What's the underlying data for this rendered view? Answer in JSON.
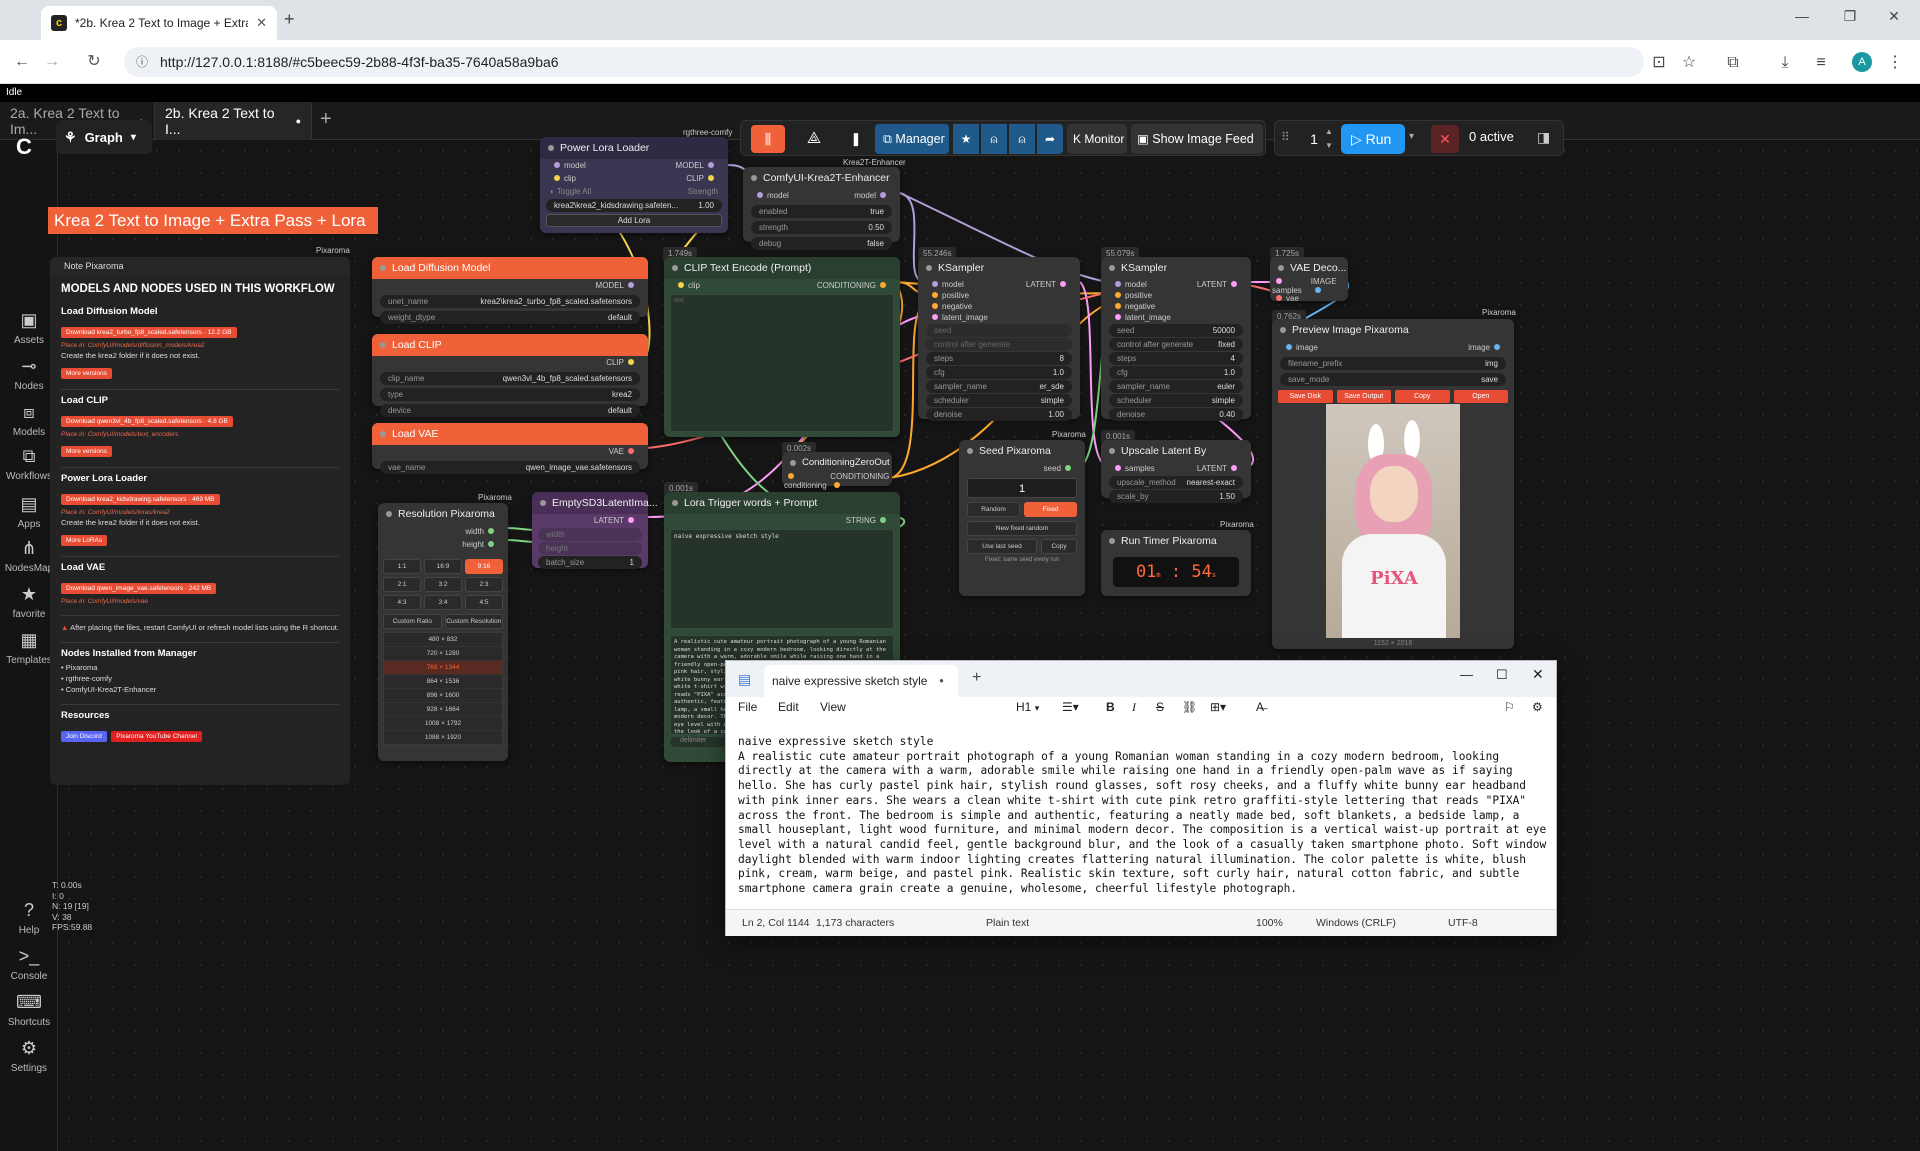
{
  "browser": {
    "tab_title": "*2b. Krea 2 Text to Image + Extra",
    "url": "http://127.0.0.1:8188/#c5beec59-2b88-4f3f-ba35-7640a58a9ba6",
    "profile_initial": "A"
  },
  "app": {
    "status": "Idle",
    "workflow_tabs": [
      {
        "label": "2a. Krea 2 Text to Im...",
        "active": false
      },
      {
        "label": "2b. Krea 2 Text to I...",
        "active": true
      }
    ],
    "graph_label": "Graph",
    "rgthree_label": "rgthree-comfy",
    "toolbar": {
      "manager": "Manager",
      "monitor": "Monitor",
      "show_image_feed": "Show Image Feed",
      "queue_count": "1",
      "run": "Run",
      "active": "0 active"
    },
    "sidebar": [
      {
        "label": "Assets",
        "icon": "image-icon"
      },
      {
        "label": "Nodes",
        "icon": "plug-icon"
      },
      {
        "label": "Models",
        "icon": "cubes-icon"
      },
      {
        "label": "Workflows",
        "icon": "workflow-icon"
      },
      {
        "label": "Apps",
        "icon": "app-icon"
      },
      {
        "label": "NodesMap",
        "icon": "map-icon"
      },
      {
        "label": "favorite",
        "icon": "star-icon"
      },
      {
        "label": "Templates",
        "icon": "template-icon"
      },
      {
        "label": "Help",
        "icon": "help-icon"
      },
      {
        "label": "Console",
        "icon": "terminal-icon"
      },
      {
        "label": "Shortcuts",
        "icon": "keyboard-icon"
      },
      {
        "label": "Settings",
        "icon": "gear-icon"
      }
    ],
    "stats": [
      "T: 0.00s",
      "I: 0",
      "N: 19 [19]",
      "V: 38",
      "FPS:59.88"
    ]
  },
  "canvas": {
    "banner": "Krea 2 Text to Image + Extra Pass + Lora",
    "note": {
      "tag": "Pixaroma",
      "title": "Note Pixaroma",
      "heading": "MODELS AND NODES USED IN THIS WORKFLOW",
      "diff_title": "Load Diffusion Model",
      "diff_dl": "Download krea2_turbo_fp8_scaled.safetensors · 12.2 GB",
      "diff_path": "Place in: ComfyUI/models/diffusion_models/krea2",
      "diff_text": "Create the  krea2  folder if it does not exist.",
      "more_versions": "More versions",
      "clip_title": "Load CLIP",
      "clip_dl": "Download qwen3vl_4b_fp8_scaled.safetensors · 4.8 GB",
      "clip_path": "Place in: ComfyUI/models/text_encoders",
      "lora_title": "Power Lora Loader",
      "lora_dl": "Download krea2_kidsdrawing.safetensors · 469 MB",
      "lora_path": "Place in: ComfyUI/models/loras/krea2",
      "lora_text": "Create the  krea2  folder if it does not exist.",
      "more_loras": "More LoRAs",
      "vae_title": "Load VAE",
      "vae_dl": "Download qwen_image_vae.safetensors · 242 MB",
      "vae_path": "Place in: ComfyUI/models/vae",
      "warning": "After placing the files, restart ComfyUI or refresh model lists using the R shortcut.",
      "installed_title": "Nodes Installed from Manager",
      "installed": [
        "Pixaroma",
        "rgthree-comfy",
        "ComfyUI-Krea2T-Enhancer"
      ],
      "resources_title": "Resources",
      "discord": "Join Discord",
      "youtube": "Pixaroma YouTube Channel"
    },
    "diffusion": {
      "title": "Load Diffusion Model",
      "out": "MODEL",
      "unet_label": "unet_name",
      "unet": "krea2\\krea2_turbo_fp8_scaled.safetensors",
      "dtype_label": "weight_dtype",
      "dtype": "default"
    },
    "clip": {
      "title": "Load CLIP",
      "out": "CLIP",
      "name_label": "clip_name",
      "name": "qwen3vl_4b_fp8_scaled.safetensors",
      "type_label": "type",
      "type": "krea2",
      "device_label": "device",
      "device": "default"
    },
    "vae": {
      "title": "Load VAE",
      "out": "VAE",
      "name_label": "vae_name",
      "name": "qwen_image_vae.safetensors"
    },
    "lora": {
      "title": "Power Lora Loader",
      "in_model": "model",
      "in_clip": "clip",
      "out_model": "MODEL",
      "out_clip": "CLIP",
      "toggle_all": "Toggle All",
      "strength_label": "Strength",
      "lora_name": "krea2\\krea2_kidsdrawing.safeten...",
      "strength": "1.00",
      "add": "Add Lora"
    },
    "enhancer": {
      "tag": "Krea2T-Enhancer",
      "title": "ComfyUI-Krea2T-Enhancer",
      "in": "model",
      "out": "model",
      "enabled_label": "enabled",
      "enabled": "true",
      "strength_label": "strength",
      "strength": "0.50",
      "debug_label": "debug",
      "debug": "false"
    },
    "clip_encode": {
      "timer": "1.749s",
      "title": "CLIP Text Encode (Prompt)",
      "in": "clip",
      "out": "CONDITIONING",
      "placeholder": "text"
    },
    "ksampler1": {
      "timer": "55.246s",
      "title": "KSampler",
      "inputs": [
        "model",
        "positive",
        "negative",
        "latent_image"
      ],
      "out": "LATENT",
      "seed_label": "seed",
      "control_label": "control after generate",
      "steps_label": "steps",
      "steps": "8",
      "cfg_label": "cfg",
      "cfg": "1.0",
      "sampler_label": "sampler_name",
      "sampler": "er_sde",
      "scheduler_label": "scheduler",
      "scheduler": "simple",
      "denoise_label": "denoise",
      "denoise": "1.00"
    },
    "ksampler2": {
      "timer": "55.079s",
      "title": "KSampler",
      "inputs": [
        "model",
        "positive",
        "negative",
        "latent_image"
      ],
      "out": "LATENT",
      "seed_label": "seed",
      "seed": "50000",
      "control_label": "control after generate",
      "control": "fixed",
      "steps_label": "steps",
      "steps": "4",
      "cfg_label": "cfg",
      "cfg": "1.0",
      "sampler_label": "sampler_name",
      "sampler": "euler",
      "scheduler_label": "scheduler",
      "scheduler": "simple",
      "denoise_label": "denoise",
      "denoise": "0.40"
    },
    "vae_decode": {
      "timer": "1.725s",
      "title": "VAE Deco...",
      "in1": "samples",
      "in2": "vae",
      "out": "IMAGE"
    },
    "preview": {
      "timer": "0.762s",
      "tag": "Pixaroma",
      "title": "Preview Image Pixaroma",
      "in": "image",
      "out": "image",
      "prefix_label": "filename_prefix",
      "prefix": "img",
      "mode_label": "save_mode",
      "mode": "save",
      "buttons": [
        "Save Disk",
        "Save Output",
        "Copy",
        "Open"
      ],
      "image_shirt_text": "PiXA",
      "size": "1152 × 2016"
    },
    "zero_out": {
      "timer": "0.002s",
      "title": "ConditioningZeroOut",
      "in": "conditioning",
      "out": "CONDITIONING"
    },
    "seed": {
      "tag": "Pixaroma",
      "title": "Seed Pixaroma",
      "out": "seed",
      "value": "1",
      "random": "Random",
      "fixed": "Fixed",
      "new_fixed": "New fixed random",
      "use_last": "Use last seed",
      "copy": "Copy",
      "hint": "Fixed: same seed every run"
    },
    "upscale": {
      "timer": "0.001s",
      "title": "Upscale Latent By",
      "in": "samples",
      "out": "LATENT",
      "method_label": "upscale_method",
      "method": "nearest-exact",
      "scale_label": "scale_by",
      "scale": "1.50"
    },
    "run_timer": {
      "tag": "Pixaroma",
      "title": "Run Timer Pixaroma",
      "minutes": "01",
      "seconds": "54"
    },
    "resolution": {
      "tag": "Pixaroma",
      "title": "Resolution Pixaroma",
      "out_w": "width",
      "out_h": "height",
      "ratios": [
        "1:1",
        "16:9",
        "9:16",
        "2:1",
        "3:2",
        "2:3",
        "4:3",
        "3:4",
        "4:5"
      ],
      "custom_ratio": "Custom Ratio",
      "custom_res": "Custom Resolution",
      "sizes": [
        "480 × 832",
        "720 × 1280",
        "768 × 1344",
        "864 × 1536",
        "896 × 1600",
        "928 × 1664",
        "1008 × 1792",
        "1088 × 1920"
      ]
    },
    "empty_latent": {
      "title": "EmptySD3LatentIma...",
      "out": "LATENT",
      "w": "width",
      "h": "height",
      "batch_label": "batch_size",
      "batch": "1"
    },
    "lora_trigger": {
      "timer": "0.001s",
      "title": "Lora Trigger words + Prompt",
      "out": "STRING",
      "trigger": "naive expressive sketch style",
      "preview": "A realistic cute amateur portrait photograph of a young Romanian woman standing in a cozy modern bedroom, looking directly at the camera with a warm, adorable smile while raising one hand in a friendly open-palm wave as if saying hello. She has curly pastel pink hair, stylish round glasses, soft rosy cheeks, and a fluffy white bunny ear headband with pink inner ears. She wears a clean white t-shirt with cute pink retro graffiti-style lettering that reads \"PIXA\" across the front. The bedroom is simple and authentic, featuring a neatly made bed, soft blankets, a bedside lamp, a small houseplant, light wood furniture, and minimal modern decor. The composition is a vertical waist-up portrait at eye level with a natural candid feel, gentle background blur, and the look of a casually taken smartphone photo. Soft window daylight blended with warm indoor lighting creates flattering natural illumination. The color palette is white, blush pink, cream, warm beige, and pastel pink.",
      "delimiter": "delimiter"
    }
  },
  "notepad": {
    "tab_title": "naive expressive sketch style",
    "menu": [
      "File",
      "Edit",
      "View"
    ],
    "heading": "H1",
    "text": "naive expressive sketch style\nA realistic cute amateur portrait photograph of a young Romanian woman standing in a cozy modern bedroom, looking directly at the camera with a warm, adorable smile while raising one hand in a friendly open-palm wave as if saying hello. She has curly pastel pink hair, stylish round glasses, soft rosy cheeks, and a fluffy white bunny ear headband with pink inner ears. She wears a clean white t-shirt with cute pink retro graffiti-style lettering that reads \"PIXA\" across the front. The bedroom is simple and authentic, featuring a neatly made bed, soft blankets, a bedside lamp, a small houseplant, light wood furniture, and minimal modern decor. The composition is a vertical waist-up portrait at eye level with a natural candid feel, gentle background blur, and the look of a casually taken smartphone photo. Soft window daylight blended with warm indoor lighting creates flattering natural illumination. The color palette is white, blush pink, cream, warm beige, and pastel pink. Realistic skin texture, soft curly hair, natural cotton fabric, and subtle smartphone camera grain create a genuine, wholesome, cheerful lifestyle photograph.",
    "status": {
      "pos": "Ln 2, Col 1144",
      "chars": "1,173 characters",
      "format": "Plain text",
      "zoom": "100%",
      "eol": "Windows (CRLF)",
      "enc": "UTF-8"
    }
  },
  "colors": {
    "accent": "#f0613a",
    "run": "#2196f3",
    "manager": "#1f5a8a",
    "canvas": "#151515"
  }
}
